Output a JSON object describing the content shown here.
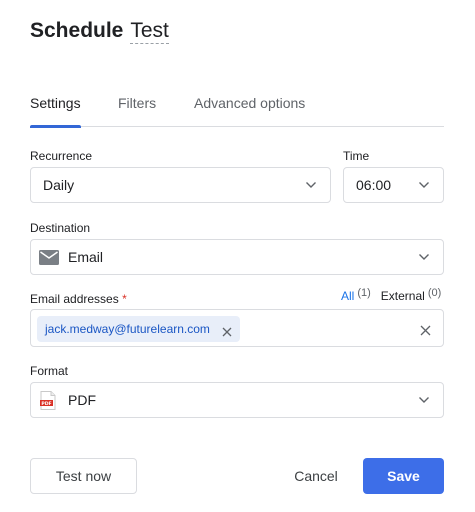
{
  "dialog": {
    "title_prefix": "Schedule",
    "title_name": "Test"
  },
  "tabs": [
    {
      "label": "Settings",
      "active": true
    },
    {
      "label": "Filters",
      "active": false
    },
    {
      "label": "Advanced options",
      "active": false
    }
  ],
  "recurrence": {
    "label": "Recurrence",
    "value": "Daily"
  },
  "time": {
    "label": "Time",
    "value": "06:00"
  },
  "destination": {
    "label": "Destination",
    "value": "Email",
    "icon": "envelope-icon"
  },
  "email": {
    "label": "Email addresses",
    "required_mark": "*",
    "mode_all": "All",
    "mode_all_count": "(1)",
    "mode_external": "External",
    "mode_external_count": "(0)",
    "chips": [
      {
        "value": "jack.medway@futurelearn.com"
      }
    ]
  },
  "format": {
    "label": "Format",
    "value": "PDF",
    "icon": "pdf-file-icon",
    "icon_text": "PDF"
  },
  "buttons": {
    "test_now": "Test now",
    "cancel": "Cancel",
    "save": "Save"
  },
  "colors": {
    "accent": "#3367d6",
    "primary_button": "#3d6ee8",
    "link": "#1a73e8",
    "chip_bg": "#e8eef9",
    "required": "#d93025"
  }
}
